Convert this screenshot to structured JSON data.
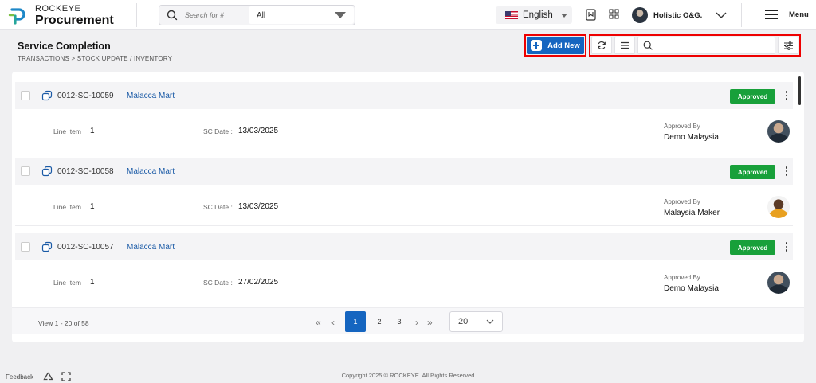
{
  "header": {
    "brand_top": "ROCKEYE",
    "brand_main": "Procurement",
    "search_placeholder": "Search for #",
    "search_scope": "All",
    "language": "English",
    "user_name": "Holistic O&G.",
    "menu_label": "Menu"
  },
  "page": {
    "title": "Service Completion",
    "breadcrumb": "TRANSACTIONS >  STOCK UPDATE / INVENTORY",
    "add_new_label": "Add New",
    "list_search_placeholder": ""
  },
  "fields": {
    "line_item_label": "Line Item :",
    "sc_date_label": "SC Date :",
    "approved_by_label": "Approved By"
  },
  "records": [
    {
      "id": "0012-SC-10059",
      "vendor": "Malacca Mart",
      "status": "Approved",
      "line_item": "1",
      "sc_date": "13/03/2025",
      "approved_by": "Demo Malaysia"
    },
    {
      "id": "0012-SC-10058",
      "vendor": "Malacca Mart",
      "status": "Approved",
      "line_item": "1",
      "sc_date": "13/03/2025",
      "approved_by": "Malaysia Maker"
    },
    {
      "id": "0012-SC-10057",
      "vendor": "Malacca Mart",
      "status": "Approved",
      "line_item": "1",
      "sc_date": "27/02/2025",
      "approved_by": "Demo Malaysia"
    }
  ],
  "pagination": {
    "view_text": "View 1 - 20 of 58",
    "pages": [
      "1",
      "2",
      "3"
    ],
    "current_page": "1",
    "page_size": "20"
  },
  "footer": {
    "feedback": "Feedback",
    "copyright": "Copyright 2025 © ROCKEYE. All Rights Reserved"
  },
  "colors": {
    "primary": "#1565c0",
    "approved": "#18a03a",
    "highlight": "#ee0000",
    "link": "#1a5aa6"
  }
}
